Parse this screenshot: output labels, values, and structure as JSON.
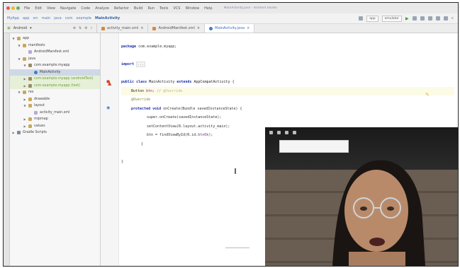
{
  "menubar": {
    "items": [
      "File",
      "Edit",
      "View",
      "Navigate",
      "Code",
      "Analyze",
      "Refactor",
      "Build",
      "Run",
      "Tools",
      "VCS",
      "Window",
      "Help"
    ],
    "title": "MainActivity.java - Android Studio"
  },
  "toolbar": {
    "breadcrumbs": [
      "MyApp",
      "app",
      "src",
      "main",
      "java",
      "com",
      "example",
      "MainActivity"
    ],
    "run_config": "app",
    "device": "emulator"
  },
  "tabs": {
    "project_dropdown": "Android",
    "open_files": [
      "activity_main.xml",
      "AndroidManifest.xml",
      "MainActivity.java"
    ]
  },
  "tree": [
    {
      "depth": 0,
      "glyph": "▼",
      "icon": "folder",
      "label": "app"
    },
    {
      "depth": 1,
      "glyph": "▼",
      "icon": "folder",
      "label": "manifests"
    },
    {
      "depth": 2,
      "glyph": "",
      "icon": "file",
      "label": "AndroidManifest.xml"
    },
    {
      "depth": 1,
      "glyph": "▼",
      "icon": "folder",
      "label": "java"
    },
    {
      "depth": 2,
      "glyph": "▼",
      "icon": "pkg",
      "label": "com.example.myapp"
    },
    {
      "depth": 3,
      "glyph": "",
      "icon": "java",
      "label": "MainActivity",
      "selected": true
    },
    {
      "depth": 2,
      "glyph": "▶",
      "icon": "pkg",
      "label": "com.example.myapp (androidTest)",
      "tone": "green"
    },
    {
      "depth": 2,
      "glyph": "▶",
      "icon": "pkg",
      "label": "com.example.myapp (test)",
      "tone": "green"
    },
    {
      "depth": 1,
      "glyph": "▼",
      "icon": "folder",
      "label": "res"
    },
    {
      "depth": 2,
      "glyph": "▶",
      "icon": "folder",
      "label": "drawable"
    },
    {
      "depth": 2,
      "glyph": "▼",
      "icon": "folder",
      "label": "layout"
    },
    {
      "depth": 3,
      "glyph": "",
      "icon": "file",
      "label": "activity_main.xml"
    },
    {
      "depth": 2,
      "glyph": "▶",
      "icon": "folder",
      "label": "mipmap"
    },
    {
      "depth": 2,
      "glyph": "▶",
      "icon": "folder",
      "label": "values"
    },
    {
      "depth": 0,
      "glyph": "▶",
      "icon": "ext",
      "label": "Gradle Scripts"
    }
  ],
  "code": {
    "package_kw": "package",
    "package_name": "com.example.myapp;",
    "import_kw": "import",
    "import_folded": "...",
    "class_public": "public",
    "class_kw": "class",
    "class_name": "MainActivity",
    "extends_kw": "extends",
    "super_class": "AppCompatActivity",
    "open_brace": "{",
    "field_type": "Button",
    "field_name": "btn;",
    "field_comment": "// ",
    "field_hint": "@Override",
    "override": "@Override",
    "method_protected": "protected",
    "method_void": "void",
    "method_sig": "onCreate(Bundle savedInstanceState) {",
    "super_call": "super.onCreate(savedInstanceState);",
    "set_content": "setContentView(R.layout.activity_main);",
    "find_view_pre": "btn = findViewById(R.id.",
    "find_view_field": "btnOk",
    "find_view_post": ");",
    "close_method": "}",
    "close_class": "}"
  },
  "colors": {
    "keyword": "#1d2fa8",
    "accent": "#3a6db8",
    "selection": "#cfd8e6",
    "warning": "#d04a2a",
    "intention_bulb": "#e0b23a"
  }
}
